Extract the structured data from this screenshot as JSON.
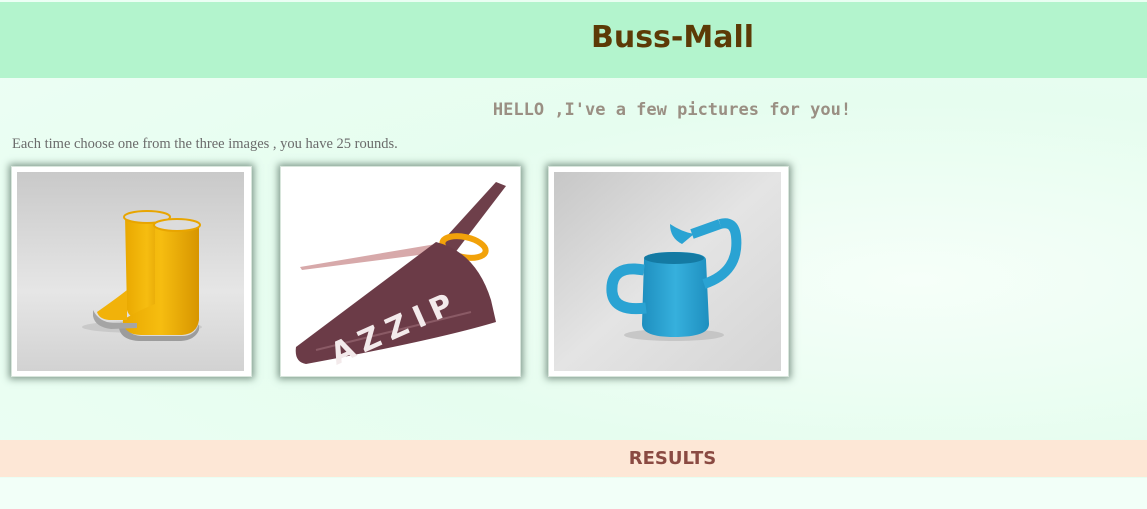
{
  "header": {
    "title": "Buss-Mall"
  },
  "main": {
    "greeting": "HELLO ,I've a few pictures for you!",
    "instructions": "Each time choose one from the three images , you have 25 rounds.",
    "products": [
      {
        "name": "boots",
        "icon": "rain-boots-image"
      },
      {
        "name": "scissors",
        "icon": "pizza-scissors-image"
      },
      {
        "name": "water-can",
        "icon": "watering-can-image"
      }
    ]
  },
  "results": {
    "label": "RESULTS"
  },
  "colors": {
    "header_bg": "#b3f4cd",
    "title": "#5c3a06",
    "greeting": "#9a8f83",
    "results_bg": "#fde7d6",
    "results_text": "#8a4a42"
  }
}
